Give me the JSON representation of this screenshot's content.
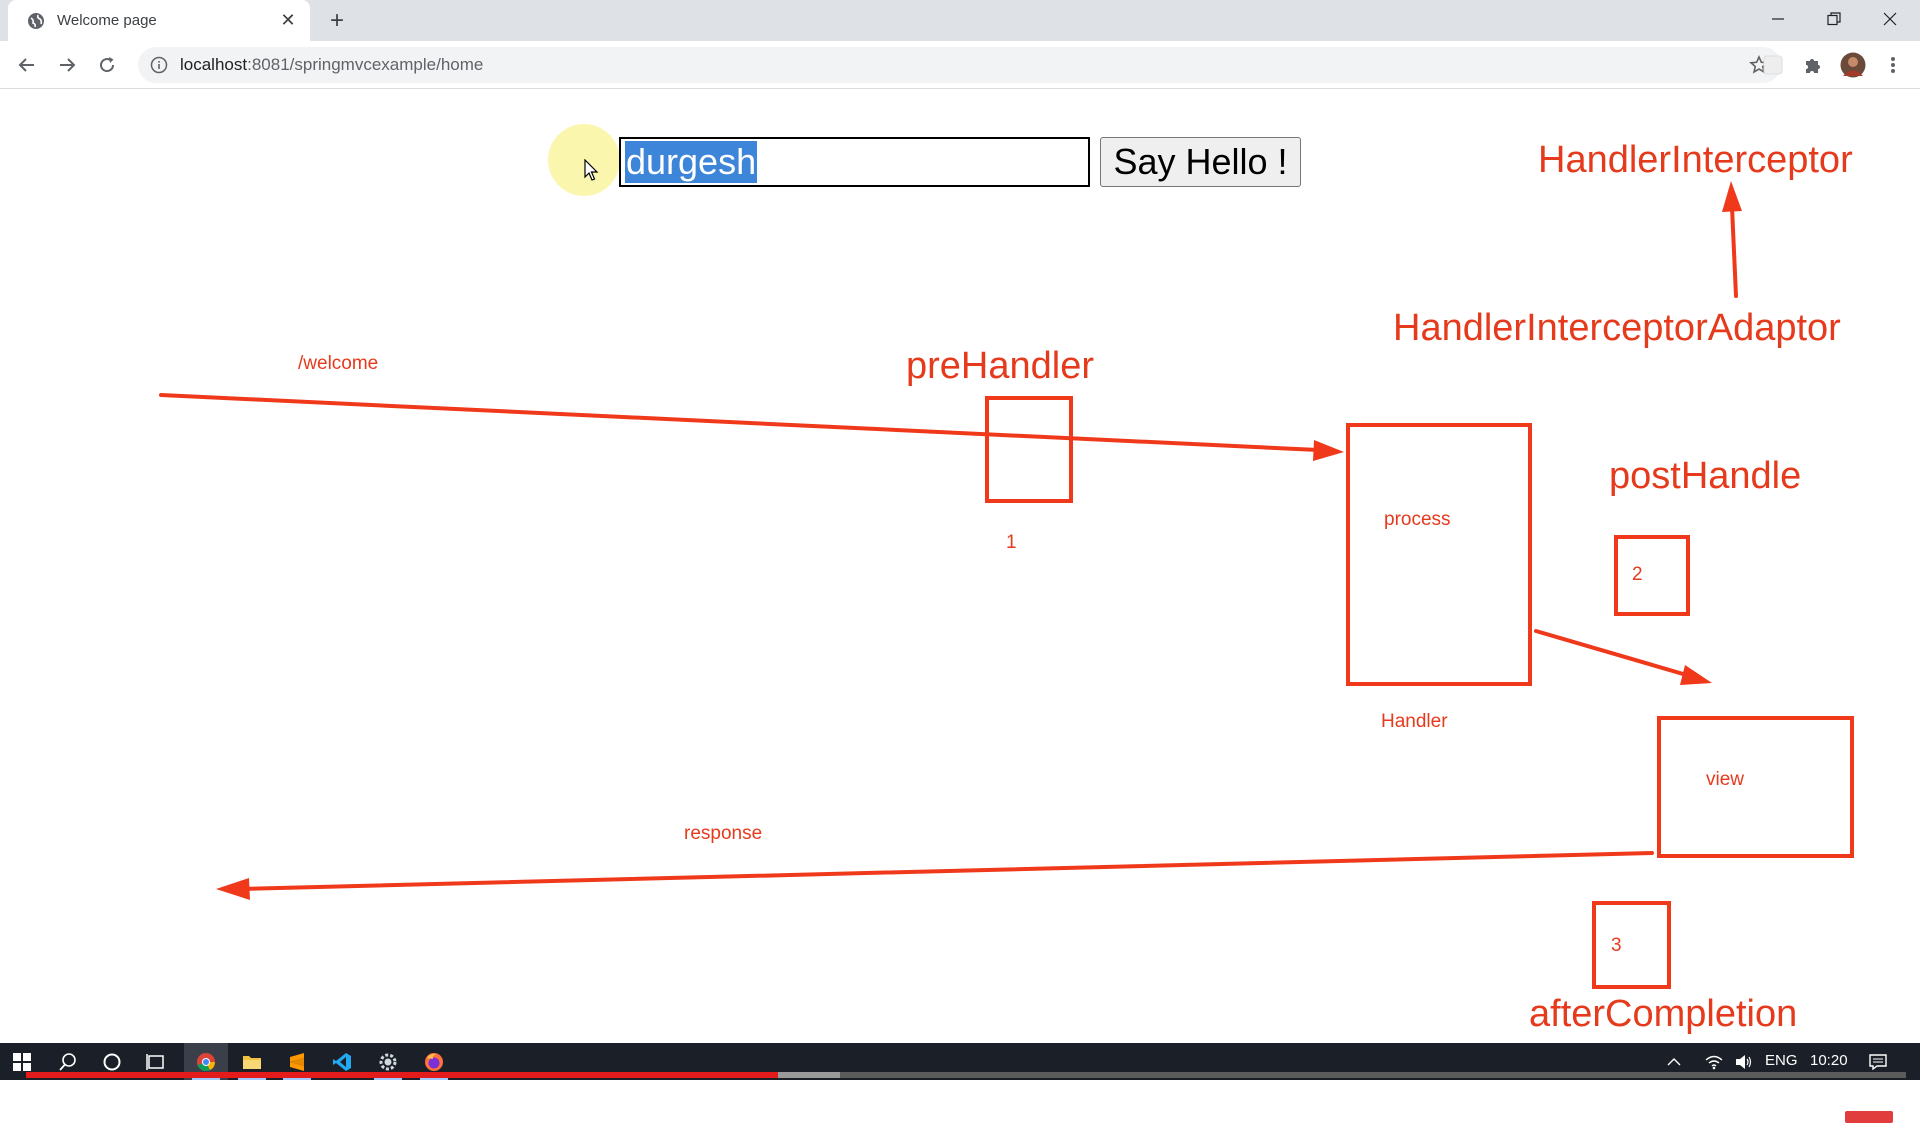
{
  "browser": {
    "tab": {
      "title": "Welcome page",
      "close_symbol": "✕"
    },
    "new_tab_symbol": "+",
    "address": {
      "host": "localhost",
      "port": ":8081",
      "path": "/springmvcexample/home"
    }
  },
  "form": {
    "name_value": "durgesh",
    "submit_label": "Say Hello !"
  },
  "diagram": {
    "handler_interceptor": "HandlerInterceptor",
    "handler_interceptor_adaptor": "HandlerInterceptorAdaptor",
    "pre_handler": "preHandler",
    "post_handle": "postHandle",
    "after_completion": "afterCompletion",
    "welcome_path": "/welcome",
    "step_1": "1",
    "step_2": "2",
    "step_3": "3",
    "process": "process",
    "handler": "Handler",
    "view": "view",
    "response": "response",
    "ink_color": "#e63a1d"
  },
  "taskbar": {
    "language": "ENG",
    "clock": "10:20",
    "apps": [
      "start-icon",
      "search-icon",
      "cortana-icon",
      "task-view-icon",
      "chrome-icon",
      "file-explorer-icon",
      "sublime-text-icon",
      "vscode-icon",
      "settings-app-icon",
      "firefox-icon"
    ],
    "video_progress": 0.4
  }
}
